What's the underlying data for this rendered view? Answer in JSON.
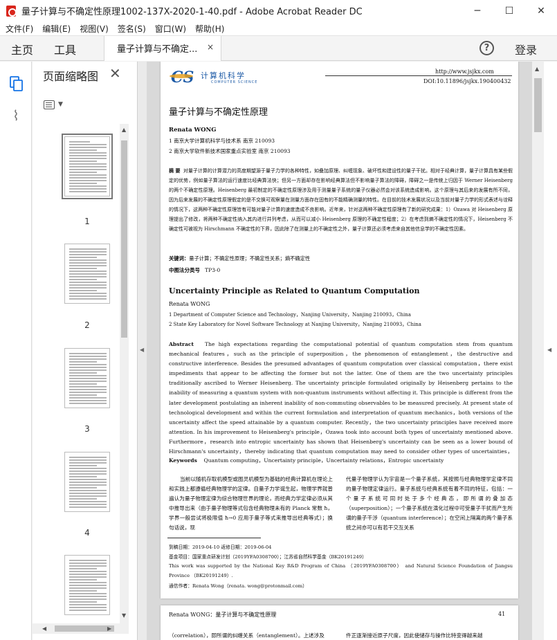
{
  "window": {
    "title": "量子计算与不确定性原理1002-137X-2020-1-40.pdf - Adobe Acrobat Reader DC",
    "minimize": "─",
    "maximize": "☐",
    "close": "✕"
  },
  "menu": [
    "文件(F)",
    "编辑(E)",
    "视图(V)",
    "签名(S)",
    "窗口(W)",
    "帮助(H)"
  ],
  "tabs": {
    "home": "主页",
    "tools": "工具",
    "doc": "量子计算与不确定...",
    "doc_close": "×",
    "help": "?",
    "login": "登录"
  },
  "panel": {
    "title": "页面缩略图",
    "close": "✕",
    "thumbs": [
      "1",
      "2",
      "3",
      "4"
    ]
  },
  "page": {
    "journal_cn": "计算机科学",
    "journal_en": "COMPUTER SCIENCE",
    "url": "http://www.jsjkx.com",
    "doi": "DOI:10.11896/jsjkx.190400432",
    "title_cn": "量子计算与不确定性原理",
    "author": "Renata WONG",
    "affil_cn_1": "1 南京大学计算机科学与技术系    南京 210093",
    "affil_cn_2": "2 南京大学软件新技术国家重点实验室    南京 210093",
    "abstract_cn_label": "摘  要",
    "abstract_cn": "对量子计算的计算潜力的高度期望源于量子力学的各种特性，如叠加原理、纠缠现象、破坏性和建设性的量子干扰。相对于经典计算，量子计算具有某些假定的优势，例如量子算法的运行速度比经典算法快；但另一方面却存在影响经典算法但不影响量子算法的障碍，障碍之一是传统上归因于 Werner Heisenberg 的两个不确定性原理。Heisenberg 最初制定的不确定性原理涉及用于测量量子系统的量子仪器必然会对该系统造成影响。这个原理与其后来的发展有所不同，因为后来发展的不确定性原理假定的是不交换可观察量在测量方面存在固有的不能精确测量的特性。在目前的技术发展状况以及当前对量子力学的形式表述与诠释的情况下，这两种不确定性原理皆有可能对量子计算的速度造成不良影响。近年来，针对这两种不确定性原理有了新的研究成果：1）Ozawa 对 Heisenberg 原理提出了修改，将两种不确定性纳入其内进行并列考虑，从而可以减小 Heisenberg 原理的不确定性程度；2）在考虑到熵不确定性的情况下，Heisenberg 不确定性可被视为 Hirschmann 不确定性的下界，因此除了在测量上的不确定性之外，量子计算还必须考虑来自其他信息学的不确定性因素。",
    "keywords_cn_label": "关键词：",
    "keywords_cn": "量子计算；不确定性原理；不确定性关系；熵不确定性",
    "clc_label": "中图法分类号",
    "clc": "TP3-0",
    "title_en": "Uncertainty Principle as Related to Quantum Computation",
    "author_en": "Renata WONG",
    "affil_en_1": "1 Department of Computer Science and Technology，Nanjing University，Nanjing 210093，China",
    "affil_en_2": "2 State Key Laboratory for Novel Software Technology at Nanjing University，Nanjing 210093，China",
    "abstract_en_label": "Abstract",
    "abstract_en": "The high expectations regarding the computational potential of quantum computation stem from quantum mechanical features，such as the principle of superposition，the phenomenon of entanglement，the destructive and constructive interference. Besides the presumed advantages of quantum computation over classical computation，there exist impediments that appear to be affecting the former but not the latter. One of them are the two uncertainty principles traditionally ascribed to Werner Heisenberg. The uncertainty principle formulated originally by Heisenberg pertains to the inability of measuring a quantum system with non-quantum instruments without affecting it. This principle is different from the later development postulating an inherent inability of non-commuting observables to be measured precisely. At present state of technological development and within the current formulation and interpretation of quantum mechanics，both versions of the uncertainty affect the speed attainable by a quantum computer. Recently，the two uncertainty principles have received more attention. In his improvement to Heisenberg's principle，Ozawa took into account both types of uncertainty mentioned above. Furthermore，research into entropic uncertainty has shown that Heisenberg's uncertainty can be seen as a lower bound of Hirschmann's uncertainty，thereby indicating that quantum computation may need to consider other types of uncertainties，such as information uncertainty，as well.",
    "keywords_en_label": "Keywords",
    "keywords_en": "Quantum computing，Uncertainty principle，Uncertainty relations，Entropic uncertainty",
    "body_left": "当前以随机存取机模型或图灵机模型为基础的经典计算机在理论上和实践上都遵循经典物理学的定律。自量子力学诞生起，物理学界就普遍认为量子物理定律为综合物理世界的理论，而经典力学定律必须从其中推导出来（由于量子物理等式包含经典物理未有的 Planck 常数 ħ，学界一般尝试将极限值 ħ→0 应用于量子等式来推导出经典等式）；换句话说，现",
    "body_right": "代量子物理学认为宇宙是一个量子系统，其按照与经典物理学定律不同的量子物理定律运行。量子系统与经典系统有着不同的特征，包括：一个量子系统可同时处于多个经典态，即所谓的叠加态（superposition）；一个量子系统在演化过程中可受量子干扰而产生所谓的量子干涉（quantum interference）；在空间上隔离的两个量子系统之间亦可以有若干交互关系",
    "received": "到稿日期：2019-04-10    返修日期：2019-06-04",
    "fund_cn": "基金项目：国家重点研发计划（2019YFA0308700）；江苏省自然科学基金（BK20191249）",
    "fund_en": "This work was supported by the National Key R&D Program of China （2019YFA0308700） and Natural Science Foundation of Jiangsu Province （BK20191249）.",
    "contact": "通信作者：Renata Wong（renata. wong@protonmail.com）"
  },
  "page2": {
    "header_left": "Renata WONG：量子计算与不确定性原理",
    "page_no": "41",
    "line_left": "（correlation），即所谓的纠缠关系（entanglement）。上述涉及",
    "line_right": "件正逐渐接近原子尺度，因此使储存与操作比特变得越来越"
  }
}
